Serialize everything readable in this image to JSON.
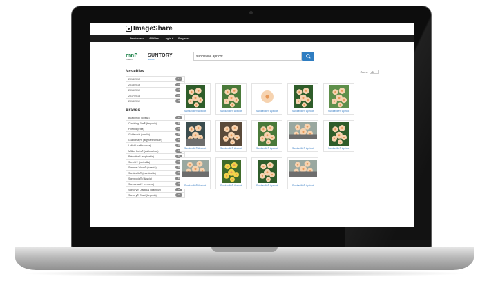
{
  "app": {
    "brand": "ImageShare"
  },
  "nav": [
    "Dashboard",
    "All files",
    "Login ▾",
    "Register"
  ],
  "logos": {
    "left": "mnP",
    "left_sub": "flowers",
    "right": "SUNTORY",
    "right_sub": "flowers"
  },
  "search": {
    "value": "sundaville apricot"
  },
  "zoom": {
    "label": "Zoom:",
    "value": "x5"
  },
  "novelties": {
    "title": "Novelties",
    "items": [
      {
        "label": "2014/2015",
        "count": "113"
      },
      {
        "label": "2015/2016",
        "count": "75"
      },
      {
        "label": "2016/2017",
        "count": "176"
      },
      {
        "label": "2017/2018",
        "count": "412"
      },
      {
        "label": "2018/2019",
        "count": "55"
      }
    ]
  },
  "brands": {
    "title": "Brands",
    "items": [
      {
        "label": "Beatiemoll (lobelia)",
        "count": "43"
      },
      {
        "label": "Crackling Fire® (begonia)",
        "count": "33"
      },
      {
        "label": "Firebird (rosa)",
        "count": "24"
      },
      {
        "label": "Goldsparkl (lobelia)",
        "count": "25"
      },
      {
        "label": "Grandessy® (argyranthemum)",
        "count": "36"
      },
      {
        "label": "Lofield (calibrachoa)",
        "count": "18"
      },
      {
        "label": "Million Bells® (calibrachoa)",
        "count": "43"
      },
      {
        "label": "Princettia® (euphorbia)",
        "count": "23"
      },
      {
        "label": "Senetti® (pericallis)",
        "count": "108"
      },
      {
        "label": "Summer Wave® (torenia)",
        "count": "9"
      },
      {
        "label": "Sundaville® (mandevilla)",
        "count": "183"
      },
      {
        "label": "Sunbeccia® (diascia)",
        "count": "47"
      },
      {
        "label": "Sunparasol® (verbena)",
        "count": "11"
      },
      {
        "label": "Suntory® Dianthus (dianthus)",
        "count": "22"
      },
      {
        "label": "Suntory® Giant (begonia)",
        "count": "29"
      }
    ]
  },
  "results": [
    {
      "caption": "Sundaville® Apricot",
      "kind": "pot"
    },
    {
      "caption": "Sundaville® Apricot",
      "kind": "bush"
    },
    {
      "caption": "Sundaville® Apricot",
      "kind": "single"
    },
    {
      "caption": "Sundaville® Apricot",
      "kind": "pot"
    },
    {
      "caption": "Sundaville® Apricot",
      "kind": "trellis"
    },
    {
      "caption": "Sundaville® Apricot",
      "kind": "greenhouse"
    },
    {
      "caption": "Sundaville® Apricot",
      "kind": "closeup"
    },
    {
      "caption": "Sundaville® Apricot",
      "kind": "bush"
    },
    {
      "caption": "Sundaville® Apricot",
      "kind": "wide"
    },
    {
      "caption": "Sundaville® Apricot",
      "kind": "pot"
    },
    {
      "caption": "Sundaville® Apricot",
      "kind": "wide"
    },
    {
      "caption": "Sundaville® Apricot",
      "kind": "yellow"
    },
    {
      "caption": "Sundaville® Apricot",
      "kind": "pot"
    },
    {
      "caption": "Sundaville® Apricot",
      "kind": "wide"
    }
  ],
  "colors": {
    "accent": "#2f7dc1",
    "navbar": "#1d1d1d",
    "badge": "#8a8a8a",
    "link": "#3a7ec4"
  }
}
